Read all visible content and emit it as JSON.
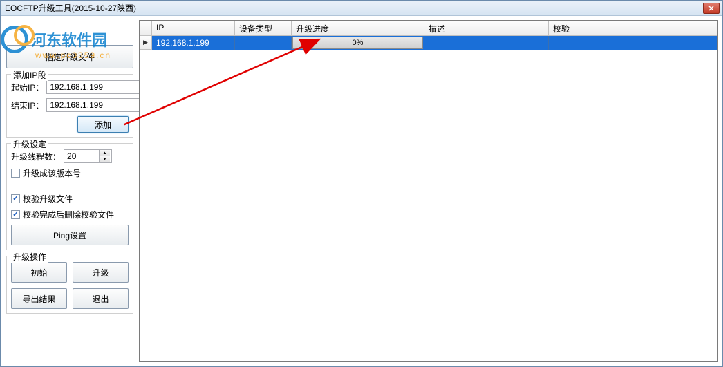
{
  "window": {
    "title": "EOCFTP升级工具(2015-10-27陕西)"
  },
  "watermark": {
    "name": "河东软件园",
    "url": "www.pc0359.cn"
  },
  "sidebar": {
    "select_file_btn": "指定升级文件",
    "ip_section": {
      "legend": "添加IP段",
      "start_label": "起始IP：",
      "start_value": "192.168.1.199",
      "end_label": "结束IP：",
      "end_value": "192.168.1.199",
      "add_btn": "添加"
    },
    "settings": {
      "legend": "升级设定",
      "threads_label": "升级线程数：",
      "threads_value": "20",
      "cb_version": "升级成该版本号",
      "cb_verify": "校验升级文件",
      "cb_delete": "校验完成后删除校验文件",
      "ping_btn": "Ping设置"
    },
    "ops": {
      "legend": "升级操作",
      "init_btn": "初始",
      "upgrade_btn": "升级",
      "export_btn": "导出结果",
      "exit_btn": "退出"
    }
  },
  "table": {
    "headers": {
      "ip": "IP",
      "dev": "设备类型",
      "prog": "升级进度",
      "desc": "描述",
      "chk": "校验"
    },
    "rows": [
      {
        "ip": "192.168.1.199",
        "dev": "",
        "progress_text": "0%",
        "desc": "",
        "chk": ""
      }
    ]
  }
}
